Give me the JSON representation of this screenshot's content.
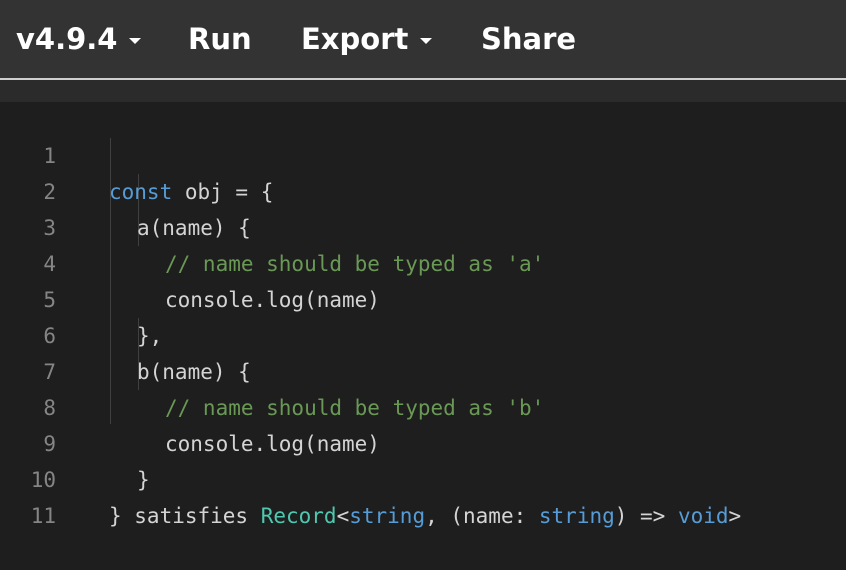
{
  "toolbar": {
    "version_label": "v4.9.4",
    "run_label": "Run",
    "export_label": "Export",
    "share_label": "Share"
  },
  "editor": {
    "line_numbers": [
      "1",
      "2",
      "3",
      "4",
      "5",
      "6",
      "7",
      "8",
      "9",
      "10",
      "11"
    ],
    "lines": {
      "l1": {
        "kw": "const",
        "rest": " obj = {"
      },
      "l2": {
        "text": "a(name) {"
      },
      "l3": {
        "comment": "// name should be typed as 'a'"
      },
      "l4": {
        "text": "console.log(name)"
      },
      "l5": {
        "text": "},"
      },
      "l6": {
        "text": "b(name) {"
      },
      "l7": {
        "comment": "// name should be typed as 'b'"
      },
      "l8": {
        "text": "console.log(name)"
      },
      "l9": {
        "text": "}"
      },
      "l10": {
        "a": "} satisfies ",
        "type_record": "Record",
        "b": "<",
        "type_string1": "string",
        "c": ", (name: ",
        "type_string2": "string",
        "d": ") => ",
        "type_void": "void",
        "e": ">"
      }
    }
  },
  "colors": {
    "keyword": "#569cd6",
    "comment": "#6a9955",
    "type": "#4ec9b0",
    "text": "#d4d4d4",
    "line_number": "#858585",
    "toolbar_bg": "#333333",
    "editor_bg": "#1e1e1e"
  }
}
